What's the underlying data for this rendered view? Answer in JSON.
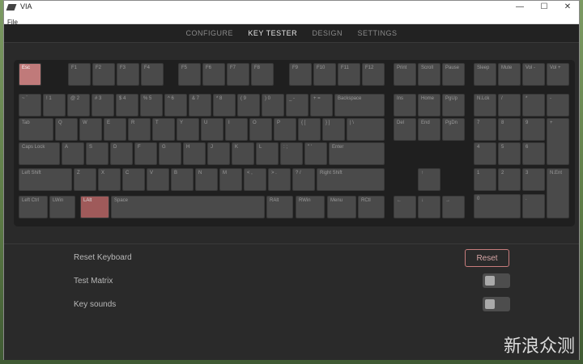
{
  "window": {
    "title": "VIA",
    "controls": [
      "—",
      "☐",
      "✕"
    ]
  },
  "menubar": {
    "file": "File"
  },
  "nav": {
    "tabs": [
      {
        "label": "CONFIGURE"
      },
      {
        "label": "KEY TESTER"
      },
      {
        "label": "DESIGN"
      },
      {
        "label": "SETTINGS"
      }
    ],
    "active": "KEY TESTER"
  },
  "keys": {
    "esc": "Esc",
    "f1": "F1",
    "f2": "F2",
    "f3": "F3",
    "f4": "F4",
    "f5": "F5",
    "f6": "F6",
    "f7": "F7",
    "f8": "F8",
    "f9": "F9",
    "f10": "F10",
    "f11": "F11",
    "f12": "F12",
    "print": "Print",
    "scroll": "Scroll",
    "pause": "Pause",
    "sleep": "Sleep",
    "mute": "Mute",
    "vold": "Vol -",
    "volu": "Vol +",
    "grave": "~ `",
    "k1": "! 1",
    "k2": "@ 2",
    "k3": "# 3",
    "k4": "$ 4",
    "k5": "% 5",
    "k6": "^ 6",
    "k7": "& 7",
    "k8": "* 8",
    "k9": "( 9",
    "k0": ") 0",
    "minus": "_ -",
    "equal": "+ =",
    "bksp": "Backspace",
    "ins": "Ins",
    "home": "Home",
    "pgup": "PgUp",
    "nlck": "N.Lck",
    "npdiv": "/",
    "npmul": "*",
    "npsub": "-",
    "tab": "Tab",
    "q": "Q",
    "w": "W",
    "e": "E",
    "r": "R",
    "t": "T",
    "y": "Y",
    "u": "U",
    "i": "I",
    "o": "O",
    "p": "P",
    "lbr": "{ [",
    "rbr": "} ]",
    "bsl": "| \\",
    "del": "Del",
    "end": "End",
    "pgdn": "PgDn",
    "np7": "7",
    "np8": "8",
    "np9": "9",
    "npadd": "+",
    "caps": "Caps Lock",
    "a": "A",
    "s": "S",
    "d": "D",
    "f": "F",
    "g": "G",
    "h": "H",
    "j": "J",
    "k": "K",
    "l": "L",
    "semi": ": ;",
    "quote": "\" '",
    "enter": "Enter",
    "np4": "4",
    "np5": "5",
    "np6": "6",
    "lshift": "Left Shift",
    "z": "Z",
    "x": "X",
    "c": "C",
    "v": "V",
    "b": "B",
    "n": "N",
    "m": "M",
    "comma": "< ,",
    "dot": "> .",
    "slash": "? /",
    "rshift": "Right Shift",
    "up": "↑",
    "np1": "1",
    "np2": "2",
    "np3": "3",
    "npent": "N.Ent",
    "lctrl": "Left Ctrl",
    "lwin": "LWin",
    "lalt": "LAlt",
    "space": "Space",
    "ralt": "RAlt",
    "rwin": "RWin",
    "menu": "Menu",
    "rctl": "RCtl",
    "left": "←",
    "down": "↓",
    "right": "→",
    "np0": "0",
    "npdot": "."
  },
  "settings": {
    "reset_keyboard": "Reset Keyboard",
    "reset_button": "Reset",
    "test_matrix": "Test Matrix",
    "key_sounds": "Key sounds"
  },
  "watermark": "新浪众测"
}
